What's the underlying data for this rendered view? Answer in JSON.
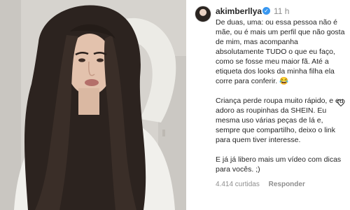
{
  "post": {
    "username": "akimberllya",
    "time": "11 h",
    "caption": [
      "De duas, uma: ou essa pessoa não é mãe, ou é mais um perfil que não gosta de mim, mas acompanha absolutamente TUDO o que eu faço, como se fosse meu maior fã. Até a etiqueta dos looks da minha filha ela corre para conferir. 😂",
      "Criança perde roupa muito rápido, e eu adoro as roupinhas da SHEIN. Eu mesma uso várias peças de lá e, sempre que compartilho, deixo o link para quem tiver interesse.",
      "E já já libero mais um vídeo com dicas para vocês. ;)"
    ],
    "likes": "4.414 curtidas",
    "reply_label": "Responder"
  },
  "icons": {
    "verified": "verified-badge-icon",
    "like": "heart-icon"
  },
  "colors": {
    "verified": "#3897f0",
    "muted": "#8e8e8e",
    "text": "#262626"
  }
}
